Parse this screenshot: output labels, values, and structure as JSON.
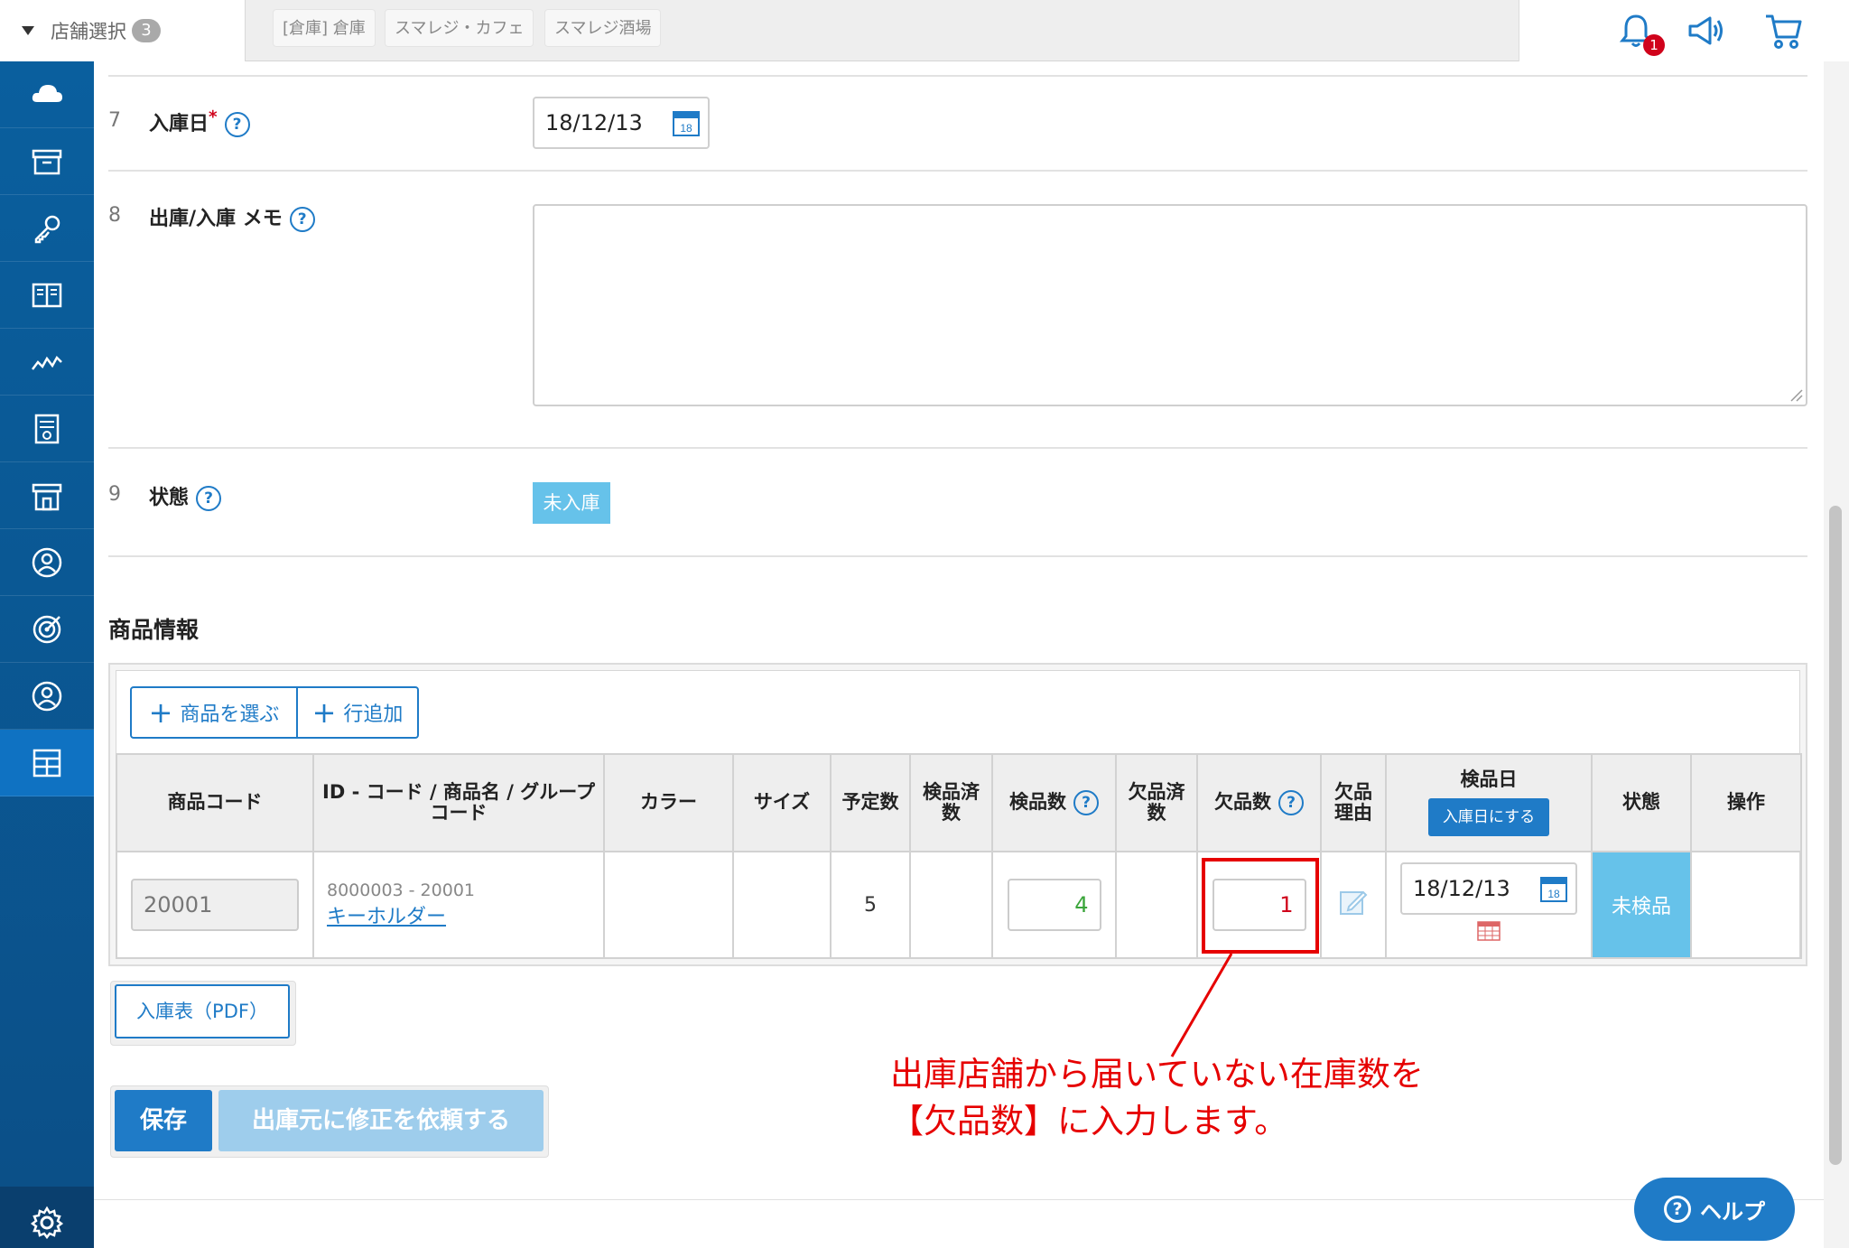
{
  "topbar": {
    "store_select_label": "店舗選択",
    "store_count": "3",
    "stores": [
      "[倉庫] 倉庫",
      "スマレジ・カフェ",
      "スマレジ酒場"
    ],
    "notification_count": "1"
  },
  "sidebar": {
    "items": [
      "cloud-icon",
      "archive-icon",
      "key-icon",
      "book-icon",
      "chart-icon",
      "report-icon",
      "store-icon",
      "user-icon",
      "target-icon",
      "account-icon",
      "grid-icon"
    ],
    "active_item": "grid-icon"
  },
  "form": {
    "row7": {
      "num": "7",
      "label": "入庫日",
      "required_mark": "*",
      "value": "18/12/13"
    },
    "row8": {
      "num": "8",
      "label": "出庫/入庫 メモ",
      "value": ""
    },
    "row9": {
      "num": "9",
      "label": "状態",
      "status": "未入庫"
    },
    "help_mark": "?"
  },
  "products": {
    "section_title": "商品情報",
    "select_button": "商品を選ぶ",
    "add_row_button": "行追加",
    "columns": {
      "code": "商品コード",
      "name": "ID - コード / 商品名 / グループコード",
      "color": "カラー",
      "size": "サイズ",
      "planned": "予定数",
      "inspected_done": "検品済数",
      "inspect_count": "検品数",
      "missing_done": "欠品済数",
      "missing_count": "欠品数",
      "missing_reason": "欠品理由",
      "inspect_date": "検品日",
      "status": "状態",
      "actions": "操作"
    },
    "set_arrival_date_button": "入庫日にする",
    "rows": [
      {
        "code": "20001",
        "id_code": "8000003 - 20001",
        "name": "キーホルダー",
        "color": "",
        "size": "",
        "planned": "5",
        "inspected_done": "",
        "inspect_count": "4",
        "missing_done": "",
        "missing_count": "1",
        "inspect_date": "18/12/13",
        "status": "未検品"
      }
    ]
  },
  "buttons": {
    "pdf": "入庫表（PDF）",
    "save": "保存",
    "request_fix": "出庫元に修正を依頼する",
    "help": "ヘルプ"
  },
  "annotation": {
    "line1": "出庫店舗から届いていない在庫数を",
    "line2": "【欠品数】に入力します。"
  },
  "colors": {
    "primary": "#1f7bc7",
    "sidebar": "#0b4f87",
    "status_badge": "#66c2ea",
    "annotation_red": "#e60000",
    "inspect_green": "#3aa53a",
    "missing_red": "#d0021b"
  }
}
